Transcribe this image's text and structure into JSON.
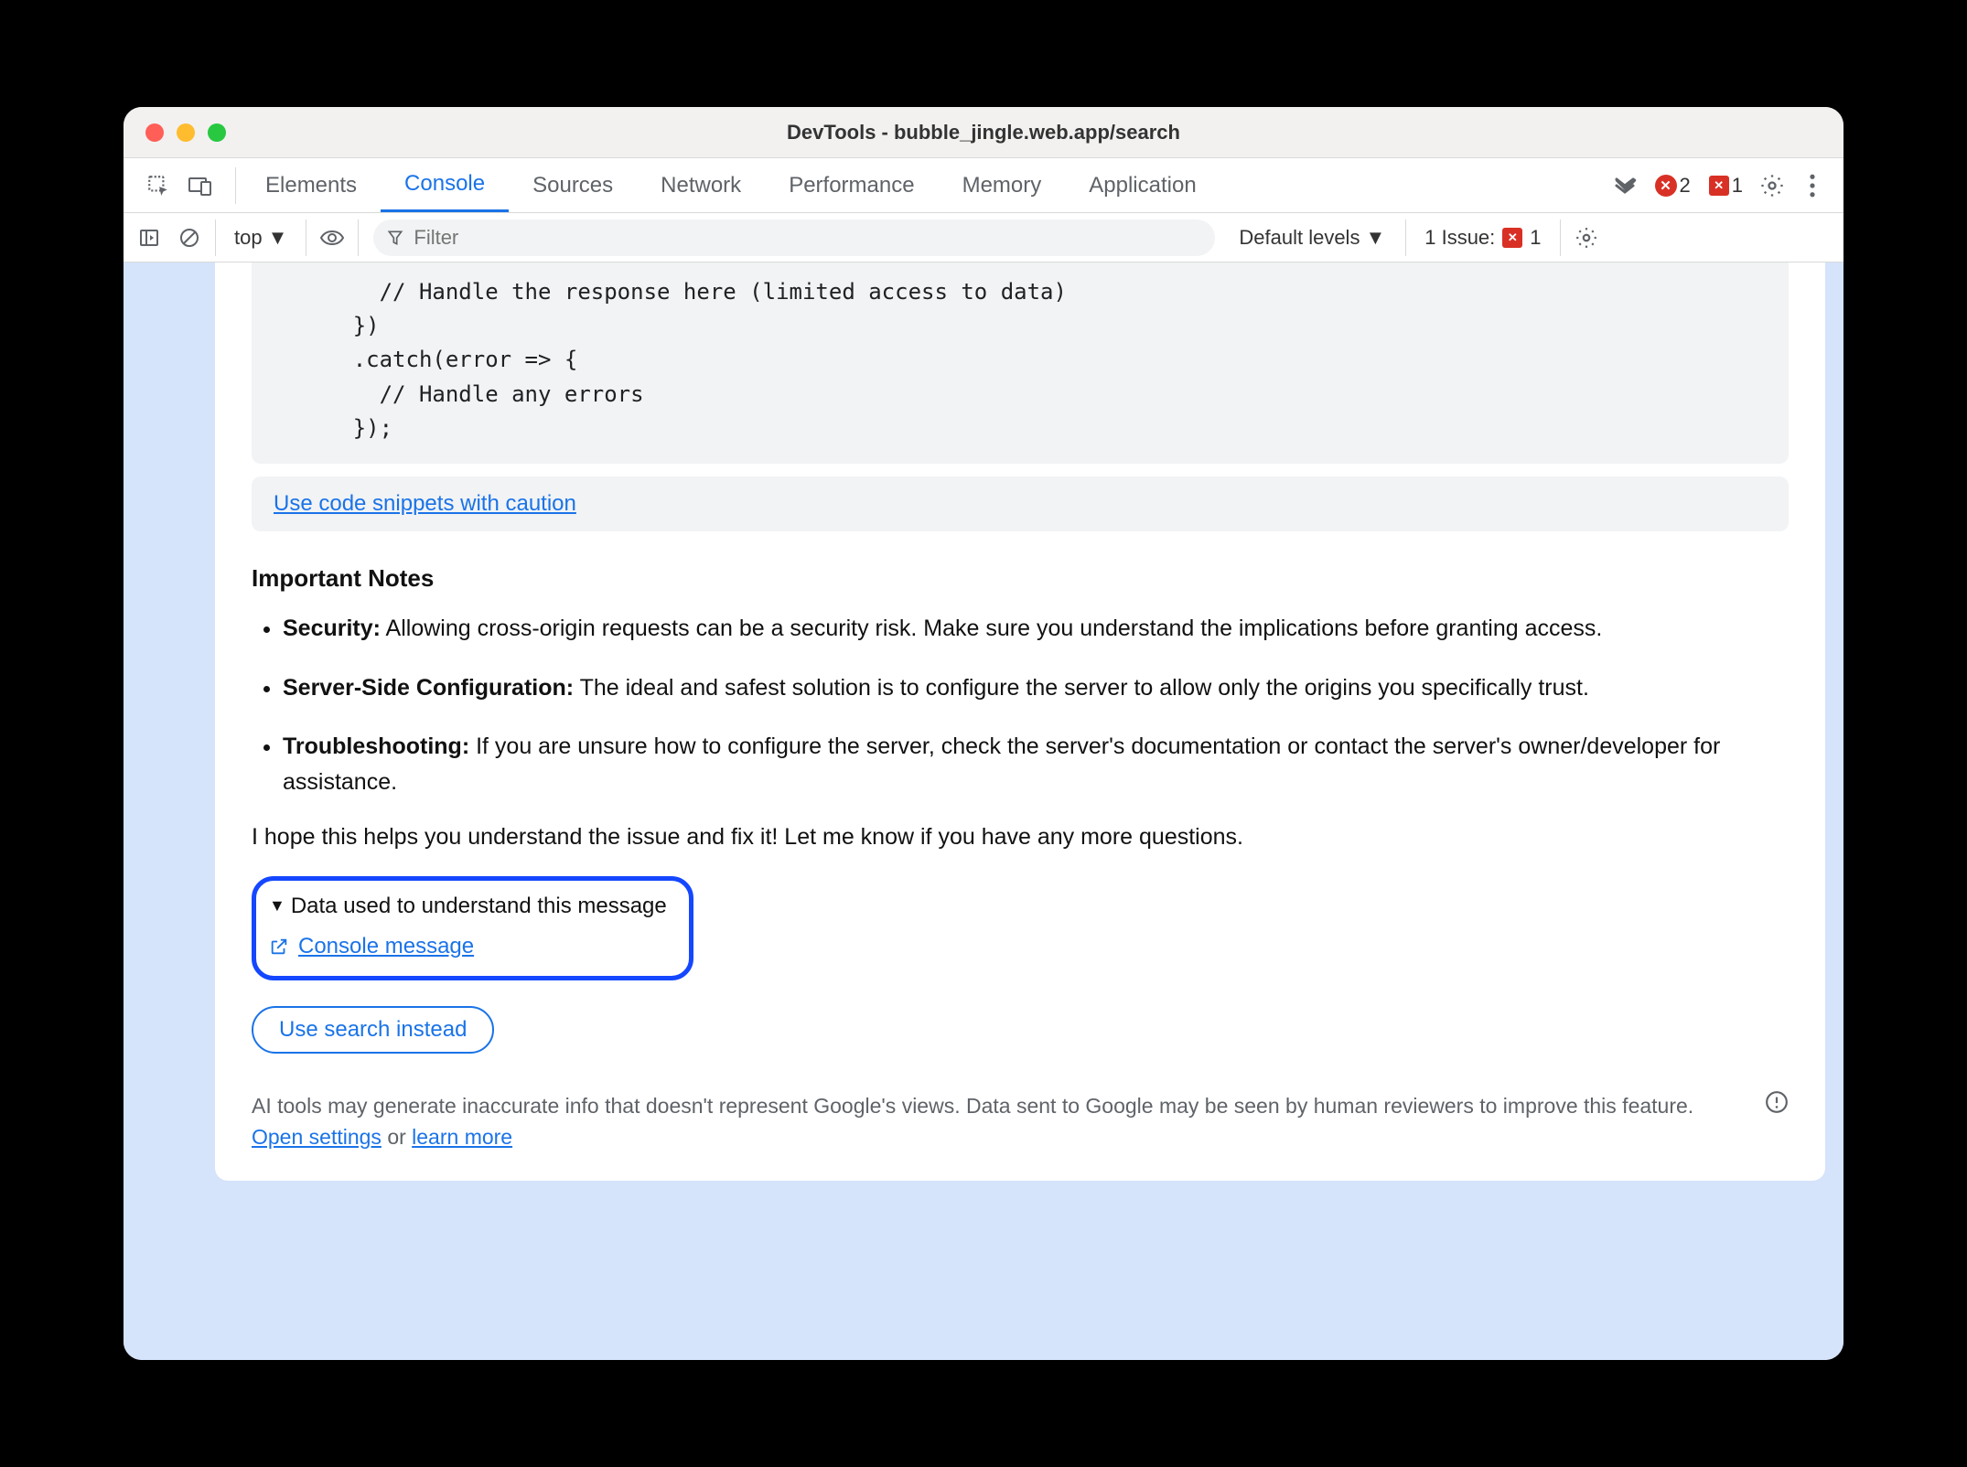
{
  "window": {
    "title": "DevTools - bubble_jingle.web.app/search"
  },
  "tabs": {
    "items": [
      "Elements",
      "Console",
      "Sources",
      "Network",
      "Performance",
      "Memory",
      "Application"
    ],
    "active_index": 1,
    "error_count": "2",
    "issue_count_top": "1"
  },
  "filterbar": {
    "context": "top",
    "filter_placeholder": "Filter",
    "levels_label": "Default levels",
    "issues_label": "1 Issue:",
    "issues_count": "1"
  },
  "code": "        // Handle the response here (limited access to data)\n      })\n      .catch(error => {\n        // Handle any errors\n      });",
  "caution_link": "Use code snippets with caution",
  "notes_heading": "Important Notes",
  "bullets": [
    {
      "label": "Security:",
      "text": " Allowing cross-origin requests can be a security risk. Make sure you understand the implications before granting access."
    },
    {
      "label": "Server-Side Configuration:",
      "text": " The ideal and safest solution is to configure the server to allow only the origins you specifically trust."
    },
    {
      "label": "Troubleshooting:",
      "text": " If you are unsure how to configure the server, check the server's documentation or contact the server's owner/developer for assistance."
    }
  ],
  "closing": "I hope this helps you understand the issue and fix it! Let me know if you have any more questions.",
  "details": {
    "summary": "Data used to understand this message",
    "link": "Console message"
  },
  "use_search": "Use search instead",
  "disclaimer": {
    "text_a": "AI tools may generate inaccurate info that doesn't represent Google's views. Data sent to Google may be seen by human reviewers to improve this feature. ",
    "open_settings": "Open settings",
    "or": " or ",
    "learn_more": "learn more"
  }
}
